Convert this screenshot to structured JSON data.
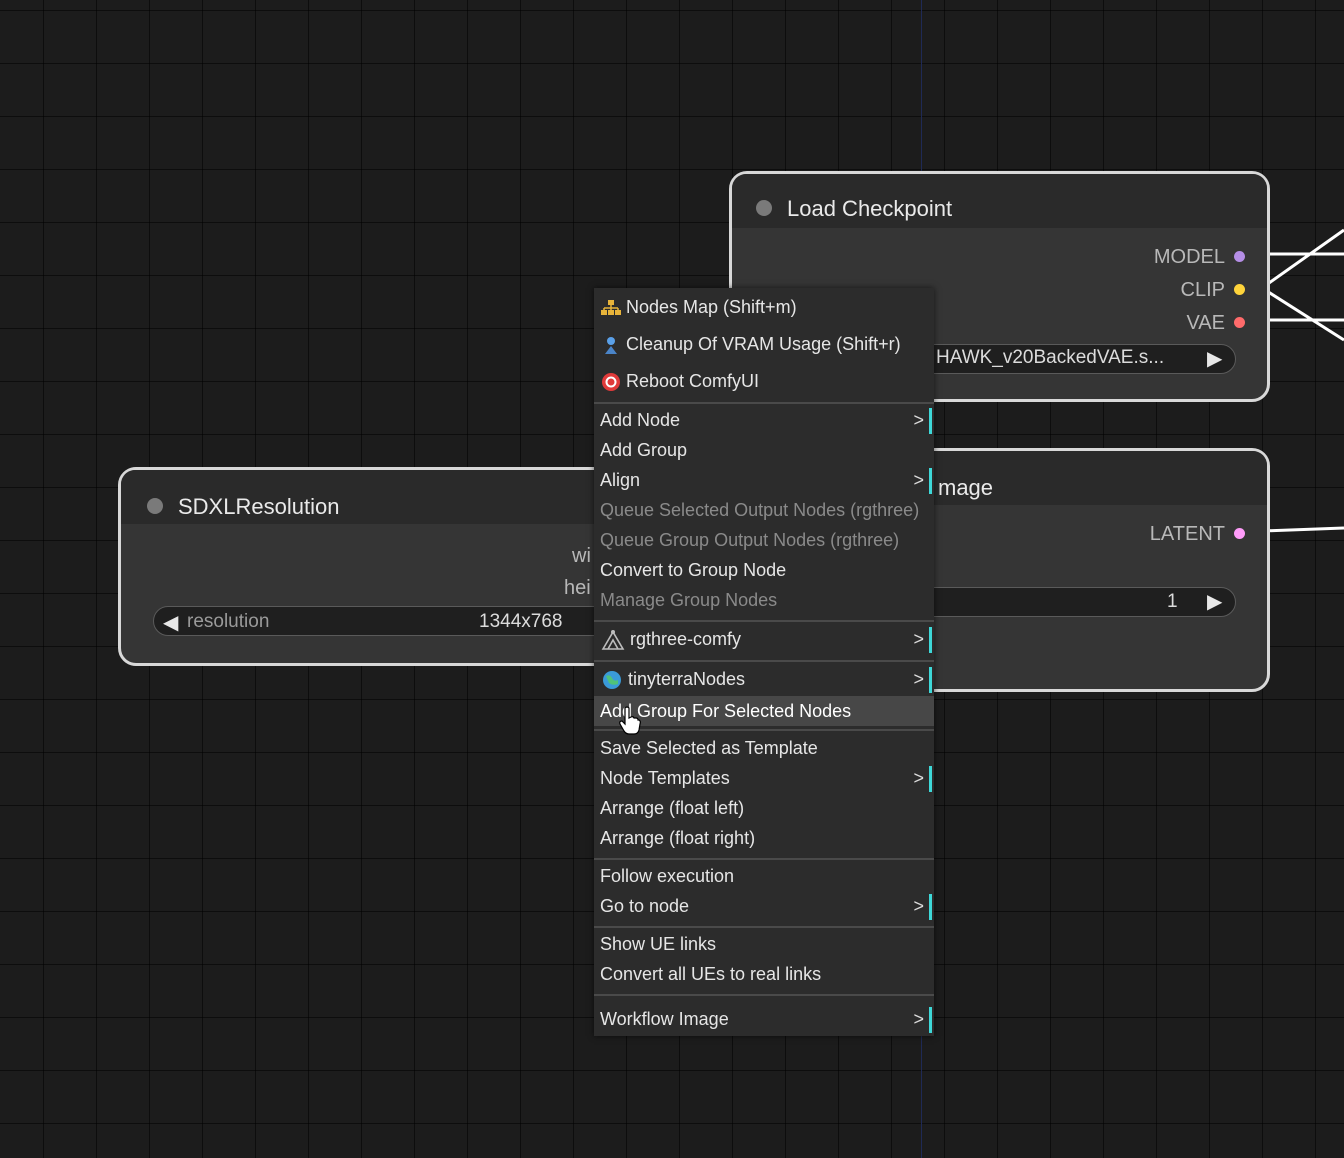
{
  "colors": {
    "canvas_bg": "#1c1c1c",
    "node_body": "#353535",
    "node_border": "#d8d8d8",
    "slot_model": "#b58ee6",
    "slot_clip": "#ffd43b",
    "slot_vae": "#ff6b6b",
    "slot_latent": "#ff9cf9",
    "submenu_accent": "#3ed8d8"
  },
  "load_checkpoint": {
    "title": "Load Checkpoint",
    "outputs": [
      "MODEL",
      "CLIP",
      "VAE"
    ],
    "ckpt_value": "HAWK_v20BackedVAE.s..."
  },
  "latent_node": {
    "title_partial": "mage",
    "output": "LATENT",
    "batch_value": "1"
  },
  "sdxl_node": {
    "title": "SDXLResolution",
    "output_partial_1": "wi",
    "output_partial_2": "hei",
    "widget_label": "resolution",
    "widget_value": "1344x768"
  },
  "context_menu": {
    "nodes_map": {
      "label": "Nodes Map (Shift+m)",
      "icon": "nodes-map-icon"
    },
    "cleanup_vram": {
      "label": "Cleanup Of VRAM Usage (Shift+r)",
      "icon": "vram-cleanup-icon"
    },
    "reboot": {
      "label": "Reboot ComfyUI",
      "icon": "reboot-icon"
    },
    "add_node": "Add Node",
    "add_group": "Add Group",
    "align": "Align",
    "queue_selected": "Queue Selected Output Nodes (rgthree)",
    "queue_group": "Queue Group Output Nodes (rgthree)",
    "convert_group": "Convert to Group Node",
    "manage_group": "Manage Group Nodes",
    "rgthree": {
      "label": "rgthree-comfy",
      "icon": "rgthree-icon"
    },
    "tinyterra": {
      "label": "tinyterraNodes",
      "icon": "globe-icon"
    },
    "add_group_selected": "Add Group For Selected Nodes",
    "save_template": "Save Selected as Template",
    "node_templates": "Node Templates",
    "arrange_left": "Arrange (float left)",
    "arrange_right": "Arrange (float right)",
    "follow_execution": "Follow execution",
    "go_to_node": "Go to node",
    "show_ue_links": "Show UE links",
    "convert_ues": "Convert all UEs to real links",
    "workflow_image": "Workflow Image",
    "submenu_symbol": ">"
  }
}
